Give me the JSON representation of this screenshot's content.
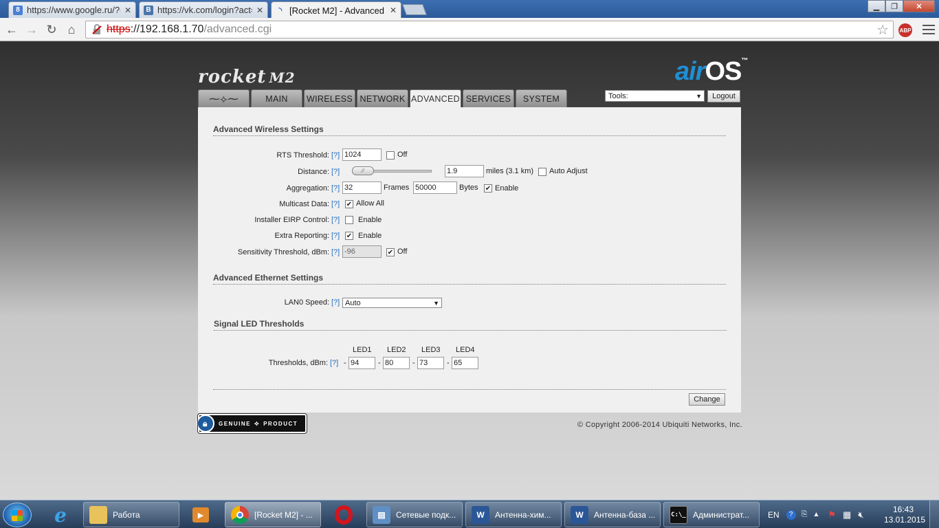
{
  "browser": {
    "tabs": [
      {
        "title": "https://www.google.ru/?g",
        "icon": "google-icon"
      },
      {
        "title": "https://vk.com/login?act=",
        "icon": "vk-icon"
      },
      {
        "title": "[Rocket M2] - Advanced",
        "icon": "rss-wave-icon"
      }
    ],
    "url": {
      "scheme": "https",
      "host": "://192.168.1.70",
      "path": "/advanced.cgi"
    },
    "abp_label": "ABP"
  },
  "header": {
    "product": "rocket",
    "model": "M2",
    "os_prefix": "air",
    "os_suffix": "OS",
    "tm": "™"
  },
  "nav": {
    "tabs": [
      "MAIN",
      "WIRELESS",
      "NETWORK",
      "ADVANCED",
      "SERVICES",
      "SYSTEM"
    ],
    "active": "ADVANCED",
    "tools_value": "Tools:",
    "logout": "Logout"
  },
  "wireless": {
    "title": "Advanced Wireless Settings",
    "help": "[?]",
    "rts": {
      "label": "RTS Threshold:",
      "value": "1024",
      "off_label": "Off",
      "off_checked": false
    },
    "distance": {
      "label": "Distance:",
      "value": "1.9",
      "unit": "miles (3.1 km)",
      "auto_label": "Auto Adjust",
      "auto_checked": false,
      "slider_level": 0.1
    },
    "aggregation": {
      "label": "Aggregation:",
      "frames": "32",
      "frames_label": "Frames",
      "bytes": "50000",
      "bytes_label": "Bytes",
      "enable_label": "Enable",
      "enable_checked": true
    },
    "multicast": {
      "label": "Multicast Data:",
      "allow_label": "Allow All",
      "checked": true
    },
    "eirp": {
      "label": "Installer EIRP Control:",
      "enable_label": "Enable",
      "checked": false
    },
    "extra": {
      "label": "Extra Reporting:",
      "enable_label": "Enable",
      "checked": true
    },
    "sensitivity": {
      "label": "Sensitivity Threshold, dBm:",
      "value": "-96",
      "off_label": "Off",
      "off_checked": true
    }
  },
  "ethernet": {
    "title": "Advanced Ethernet Settings",
    "lan0": {
      "label": "LAN0 Speed:",
      "value": "Auto"
    }
  },
  "led": {
    "title": "Signal LED Thresholds",
    "headers": [
      "LED1",
      "LED2",
      "LED3",
      "LED4"
    ],
    "label": "Thresholds, dBm:",
    "dash": "-",
    "values": [
      "94",
      "80",
      "73",
      "65"
    ]
  },
  "actions": {
    "change": "Change"
  },
  "footer": {
    "genuine": "GENUINE",
    "product": "PRODUCT",
    "copyright": "© Copyright 2006-2014 Ubiquiti Networks, Inc."
  },
  "taskbar": {
    "tasks": [
      {
        "label": "Работа",
        "icon": "folder-icon"
      },
      {
        "label": "[Rocket M2] - ...",
        "icon": "chrome-icon"
      },
      {
        "label": "Сетевые подк...",
        "icon": "network-icon"
      },
      {
        "label": "Антенна-хим...",
        "icon": "word-icon"
      },
      {
        "label": "Антенна-база ...",
        "icon": "word-icon"
      },
      {
        "label": "Администрат...",
        "icon": "cmd-icon"
      }
    ],
    "lang": "EN",
    "time": "16:43",
    "date": "13.01.2015"
  },
  "colors": {
    "accent": "#1e8fd6",
    "help_link": "#1f6fbf",
    "taskbar": "#2c4566"
  }
}
